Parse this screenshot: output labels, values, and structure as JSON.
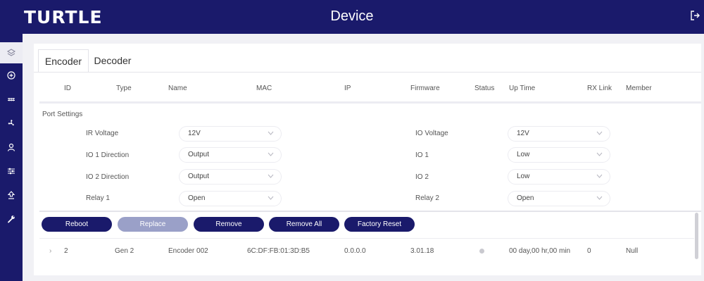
{
  "header": {
    "logo": "TURTLE",
    "title": "Device"
  },
  "tabs": {
    "encoder": "Encoder",
    "decoder": "Decoder"
  },
  "columns": [
    "ID",
    "Type",
    "Name",
    "MAC",
    "IP",
    "Firmware",
    "Status",
    "Up Time",
    "RX Link",
    "Member"
  ],
  "port_settings": {
    "title": "Port Settings",
    "ir_voltage": {
      "label": "IR Voltage",
      "value": "12V"
    },
    "io1_direction": {
      "label": "IO 1 Direction",
      "value": "Output"
    },
    "io2_direction": {
      "label": "IO 2 Direction",
      "value": "Output"
    },
    "relay1": {
      "label": "Relay 1",
      "value": "Open"
    },
    "io_voltage": {
      "label": "IO Voltage",
      "value": "12V"
    },
    "io1": {
      "label": "IO 1",
      "value": "Low"
    },
    "io2": {
      "label": "IO 2",
      "value": "Low"
    },
    "relay2": {
      "label": "Relay 2",
      "value": "Open"
    }
  },
  "actions": {
    "reboot": "Reboot",
    "replace": "Replace",
    "remove": "Remove",
    "remove_all": "Remove All",
    "factory_reset": "Factory Reset"
  },
  "row": {
    "expander": "›",
    "id": "2",
    "type": "Gen 2",
    "name": "Encoder 002",
    "mac": "6C:DF:FB:01:3D:B5",
    "ip": "0.0.0.0",
    "firmware": "3.01.18",
    "uptime": "00 day,00 hr,00 min",
    "rx_link": "0",
    "member": "Null"
  },
  "colors": {
    "brand": "#1a1a6b",
    "status_dot": "#c9c9cf",
    "disabled_button": "#9aa0c8"
  },
  "icons": [
    "layers-icon",
    "plus-circle-icon",
    "grid-icon",
    "fan-icon",
    "user-icon",
    "sliders-icon",
    "upload-icon",
    "wrench-icon",
    "logout-icon"
  ]
}
